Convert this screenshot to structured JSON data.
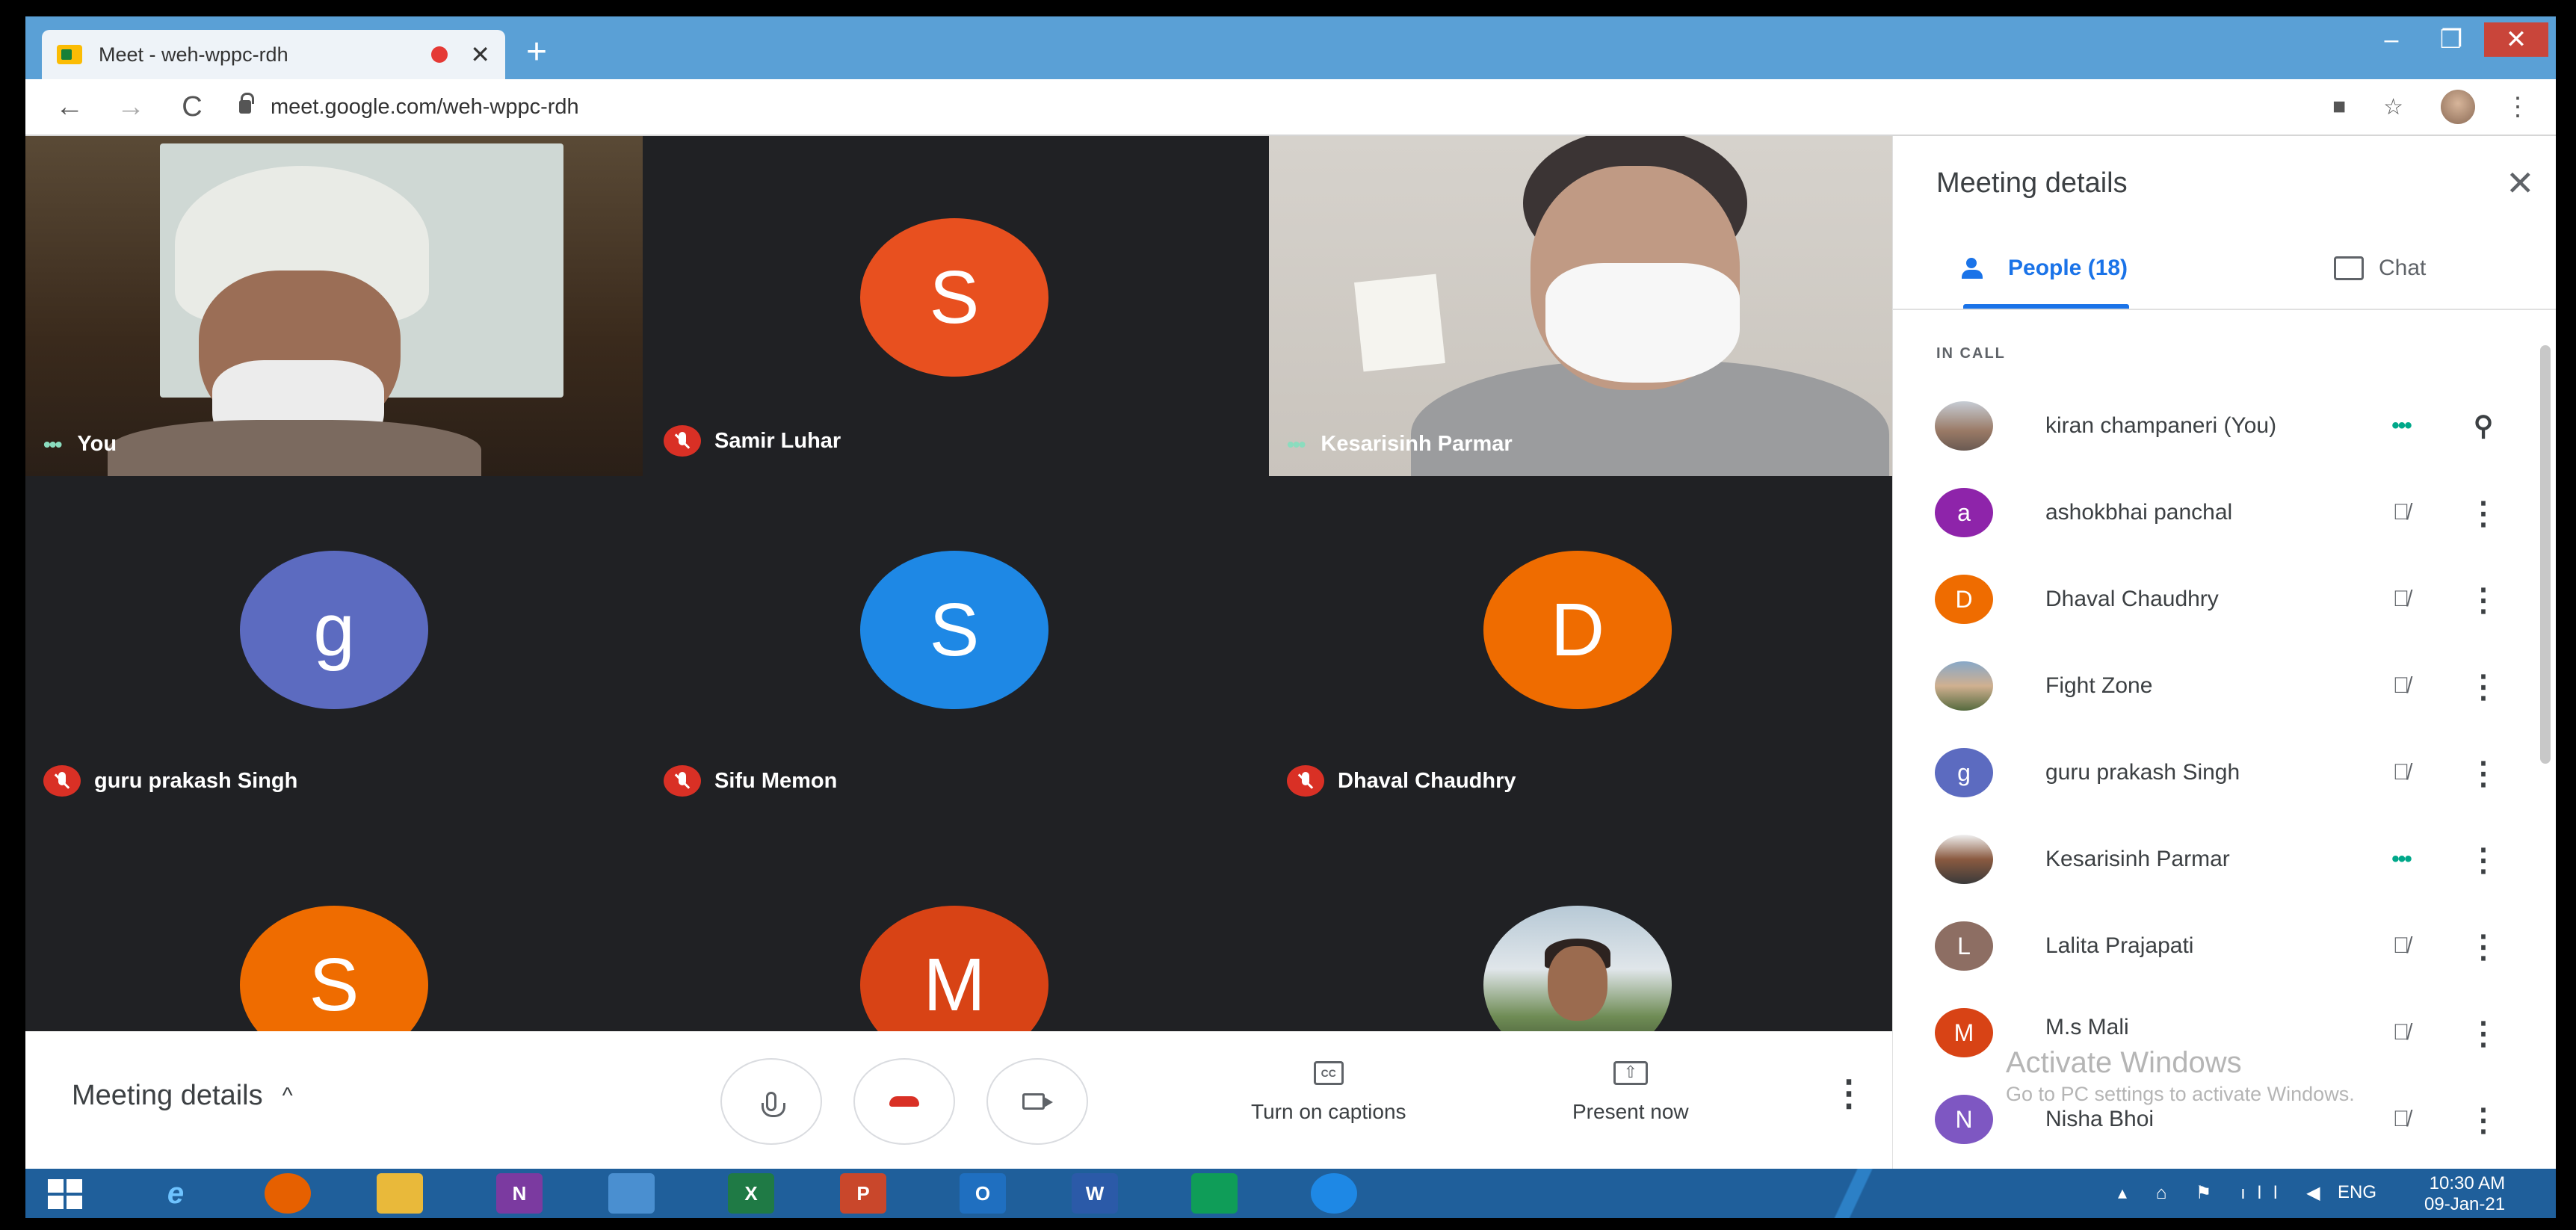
{
  "browser": {
    "tab_title": "Meet - weh-wppc-rdh",
    "tab_close": "✕",
    "new_tab": "+",
    "url": "meet.google.com/weh-wppc-rdh",
    "window_controls": {
      "minimize": "–",
      "maximize": "❐",
      "close": "✕"
    },
    "nav": {
      "back": "←",
      "forward": "→",
      "reload": "C"
    },
    "toolbar_icons": {
      "extension": "■",
      "star": "☆",
      "menu": "⋮"
    }
  },
  "tiles": [
    {
      "name": "You",
      "type": "video",
      "status": "speaking"
    },
    {
      "name": "Samir Luhar",
      "type": "initial",
      "initial": "S",
      "color": "#e8501f",
      "status": "muted"
    },
    {
      "name": "Kesarisinh Parmar",
      "type": "video",
      "status": "speaking"
    },
    {
      "name": "guru prakash Singh",
      "type": "initial",
      "initial": "g",
      "color": "#5c6bc0",
      "status": "muted"
    },
    {
      "name": "Sifu Memon",
      "type": "initial",
      "initial": "S",
      "color": "#1e88e5",
      "status": "muted"
    },
    {
      "name": "Dhaval Chaudhry",
      "type": "initial",
      "initial": "D",
      "color": "#ef6c00",
      "status": "muted"
    },
    {
      "name": "",
      "type": "initial",
      "initial": "S",
      "color": "#ef6c00"
    },
    {
      "name": "",
      "type": "initial",
      "initial": "M",
      "color": "#d84315"
    },
    {
      "name": "",
      "type": "photo"
    }
  ],
  "speaking_dots": "•••",
  "controls": {
    "meeting_details": "Meeting details",
    "chevron": "^",
    "captions_label": "Turn on captions",
    "captions_icon": "CC",
    "present_label": "Present now",
    "present_icon": "⇧",
    "more": "⋮"
  },
  "panel": {
    "title": "Meeting details",
    "close": "✕",
    "people_tab": "People (18)",
    "chat_tab": "Chat",
    "in_call": "IN CALL",
    "participants": [
      {
        "name": "kiran champaneri (You)",
        "avatar": "photo1",
        "status": "•••",
        "action": "⚲"
      },
      {
        "name": "ashokbhai panchal",
        "initial": "a",
        "color": "#8e24aa",
        "status": "🎙̸",
        "action": "⋮"
      },
      {
        "name": "Dhaval Chaudhry",
        "initial": "D",
        "color": "#ef6c00",
        "status": "🎙̸",
        "action": "⋮"
      },
      {
        "name": "Fight Zone",
        "avatar": "photo2",
        "status": "🎙̸",
        "action": "⋮"
      },
      {
        "name": "guru prakash Singh",
        "initial": "g",
        "color": "#5c6bc0",
        "status": "🎙̸",
        "action": "⋮"
      },
      {
        "name": "Kesarisinh Parmar",
        "avatar": "photo3",
        "status": "•••",
        "action": "⋮"
      },
      {
        "name": "Lalita Prajapati",
        "initial": "L",
        "color": "#8d6e63",
        "status": "🎙̸",
        "action": "⋮"
      },
      {
        "name": "M.s Mali",
        "initial": "M",
        "color": "#d84315",
        "status": "🎙̸",
        "action": "⋮"
      },
      {
        "name": "Nisha Bhoi",
        "initial": "N",
        "color": "#7e57c2",
        "status": "🎙̸",
        "action": "⋮"
      }
    ]
  },
  "watermark": {
    "title": "Activate Windows",
    "subtitle": "Go to PC settings to activate Windows."
  },
  "taskbar": {
    "apps": [
      {
        "label": "e",
        "color": "#1f5f9b",
        "name": "internet-explorer-icon"
      },
      {
        "label": "",
        "color": "#e66000",
        "name": "firefox-icon"
      },
      {
        "label": "",
        "color": "#e9b93a",
        "name": "file-explorer-icon"
      },
      {
        "label": "N",
        "color": "#7b3aa0",
        "name": "onenote-icon"
      },
      {
        "label": "",
        "color": "#4a8fd0",
        "name": "chrome-icon"
      },
      {
        "label": "X",
        "color": "#1f7a45",
        "name": "excel-icon"
      },
      {
        "label": "P",
        "color": "#c9472b",
        "name": "powerpoint-icon"
      },
      {
        "label": "O",
        "color": "#1f6fc0",
        "name": "outlook-icon"
      },
      {
        "label": "W",
        "color": "#2b5aa8",
        "name": "word-icon"
      },
      {
        "label": "",
        "color": "#0f9d58",
        "name": "store-icon"
      },
      {
        "label": "",
        "color": "#1e88e5",
        "name": "edge-icon"
      }
    ],
    "tray": "▴ ⌂ ⚑ ıll ◀",
    "lang": "ENG",
    "time": "10:30 AM",
    "date": "09-Jan-21"
  }
}
